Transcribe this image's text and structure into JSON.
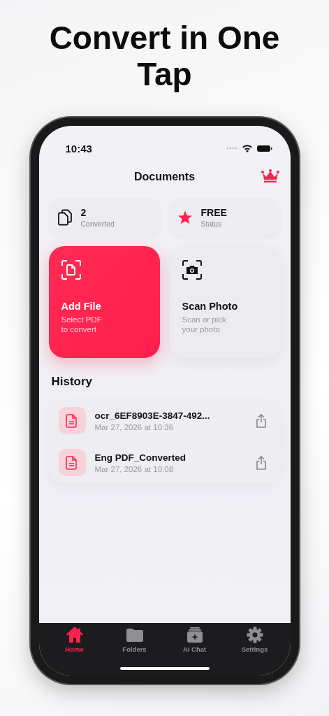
{
  "headline": "Convert in One Tap",
  "status_bar": {
    "time": "10:43"
  },
  "header": {
    "title": "Documents"
  },
  "stats": [
    {
      "kind": "converted",
      "value": "2",
      "label": "Converted"
    },
    {
      "kind": "status",
      "value": "FREE",
      "label": "Status"
    }
  ],
  "actions": [
    {
      "kind": "file",
      "title": "Add File",
      "subtitle": "Select PDF\nto convert"
    },
    {
      "kind": "scan",
      "title": "Scan Photo",
      "subtitle": "Scan or pick\n your photo"
    }
  ],
  "history": {
    "title": "History",
    "items": [
      {
        "name": "ocr_6EF8903E-3847-492...",
        "date": "Mar 27, 2026 at 10:36"
      },
      {
        "name": "Eng PDF_Converted",
        "date": "Mar 27, 2026 at 10:08"
      }
    ]
  },
  "tabs": [
    {
      "kind": "home",
      "label": "Home",
      "selected": true
    },
    {
      "kind": "folders",
      "label": "Folders",
      "selected": false
    },
    {
      "kind": "chat",
      "label": "AI Chat",
      "selected": false
    },
    {
      "kind": "settings",
      "label": "Settings",
      "selected": false
    }
  ]
}
